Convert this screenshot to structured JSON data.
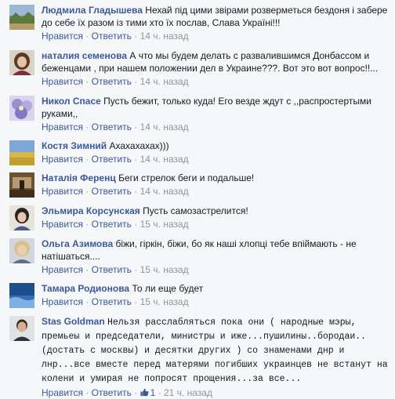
{
  "actions": {
    "like": "Нравится",
    "reply": "Ответить",
    "separator": "·"
  },
  "comments": [
    {
      "author": "Людмила Гладышева",
      "text": "Нехай під цими звірами розверметься бездоня і забере до себе їх разом із тими хто їх послав, Слава Україні!!!",
      "time": "14 ч. назад",
      "avatar_icon": "landscape-avatar"
    },
    {
      "author": "наталия семенова",
      "text": "А что мы будем делать с развалившимся Донбассом и беженцами , при нашем положении дел в Украине???. Вот это вот вопрос!!...",
      "time": "14 ч. назад",
      "avatar_icon": "woman-avatar"
    },
    {
      "author": "Никол Спасе",
      "text": "Пусть бежит, только куда! Его везде ждут с ,,распростертыми руками,,",
      "time": "14 ч. назад",
      "avatar_icon": "flowers-avatar"
    },
    {
      "author": "Костя Зимний",
      "text": "Ахахахахах)))",
      "time": "14 ч. назад",
      "avatar_icon": "field-avatar"
    },
    {
      "author": "Наталія Ференц",
      "text": "Беги стрелок беги и подальше!",
      "time": "14 ч. назад",
      "avatar_icon": "room-avatar"
    },
    {
      "author": "Эльмира Корсунская",
      "text": "Пусть самозастрелится!",
      "time": "15 ч. назад",
      "avatar_icon": "woman-avatar"
    },
    {
      "author": "Ольга Азимова",
      "text": "біжи, гіркін, біжи, бо як наші хлопці тебе впіймають - не натішаться....",
      "time": "15 ч. назад",
      "avatar_icon": "portrait-avatar"
    },
    {
      "author": "Тамара Родионова",
      "text": "То ли еще будет",
      "time": "15 ч. назад",
      "avatar_icon": "sky-avatar"
    },
    {
      "author": "Stas Goldman",
      "text": "Нельзя расслабляться пока они ( народные мэры, премьеы и председатели, министры и иже...пушилины..бородаи..(достать с москвы) и десятки других ) со знаменами днр и лнр...все вместе перед матерями погибших украинцев не встанут на колени и умирая не попросят прощения...за все...",
      "time": "21 ч. назад",
      "like_count": "1",
      "avatar_icon": "man-avatar"
    }
  ],
  "colors": {
    "link": "#3b5998",
    "meta": "#90949c",
    "text": "#141823",
    "background": "#f6f7f9"
  }
}
